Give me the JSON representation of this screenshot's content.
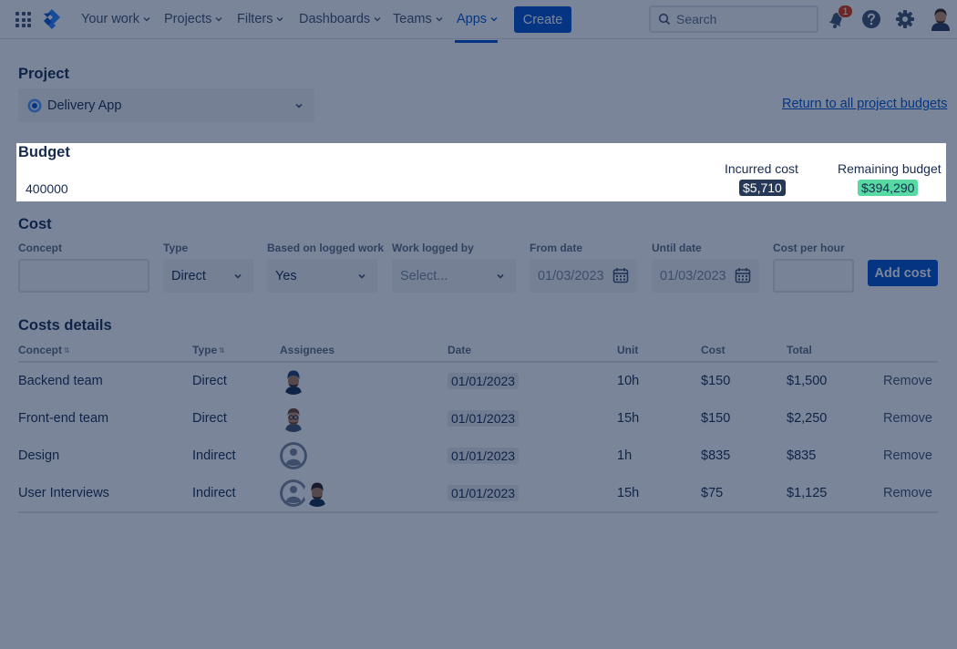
{
  "nav": {
    "items": [
      {
        "label": "Your work"
      },
      {
        "label": "Projects"
      },
      {
        "label": "Filters"
      },
      {
        "label": "Dashboards"
      },
      {
        "label": "Teams"
      },
      {
        "label": "Apps"
      }
    ],
    "active_item": "Apps",
    "create_label": "Create",
    "search_placeholder": "Search",
    "notification_count": "1"
  },
  "project": {
    "heading": "Project",
    "selected": "Delivery App",
    "return_link": "Return to all project budgets"
  },
  "budget": {
    "heading": "Budget",
    "value": "400000",
    "incurred_label": "Incurred cost",
    "incurred_value": "$5,710",
    "remaining_label": "Remaining budget",
    "remaining_value": "$394,290"
  },
  "cost_form": {
    "heading": "Cost",
    "labels": {
      "concept": "Concept",
      "type": "Type",
      "based_on": "Based on logged work",
      "logged_by": "Work logged by",
      "from_date": "From date",
      "until_date": "Until date",
      "cost_per_hour": "Cost per hour"
    },
    "type_value": "Direct",
    "based_on_value": "Yes",
    "logged_by_placeholder": "Select...",
    "from_date_value": "01/03/2023",
    "until_date_value": "01/03/2023",
    "add_label": "Add cost"
  },
  "costs_table": {
    "heading": "Costs details",
    "columns": {
      "concept": "Concept",
      "type": "Type",
      "assignees": "Assignees",
      "date": "Date",
      "unit": "Unit",
      "cost": "Cost",
      "total": "Total"
    },
    "rows": [
      {
        "concept": "Backend team",
        "type": "Direct",
        "date": "01/01/2023",
        "unit": "10h",
        "cost": "$150",
        "total": "$1,500",
        "action": "Remove"
      },
      {
        "concept": "Front-end team",
        "type": "Direct",
        "date": "01/01/2023",
        "unit": "15h",
        "cost": "$150",
        "total": "$2,250",
        "action": "Remove"
      },
      {
        "concept": "Design",
        "type": "Indirect",
        "date": "01/01/2023",
        "unit": "1h",
        "cost": "$835",
        "total": "$835",
        "action": "Remove"
      },
      {
        "concept": "User Interviews",
        "type": "Indirect",
        "date": "01/01/2023",
        "unit": "15h",
        "cost": "$75",
        "total": "$1,125",
        "action": "Remove"
      }
    ]
  },
  "colors": {
    "brand": "#0052CC",
    "overlay": "#091E42",
    "remaining_badge": "#57D9A3",
    "incurred_badge": "#253858"
  }
}
